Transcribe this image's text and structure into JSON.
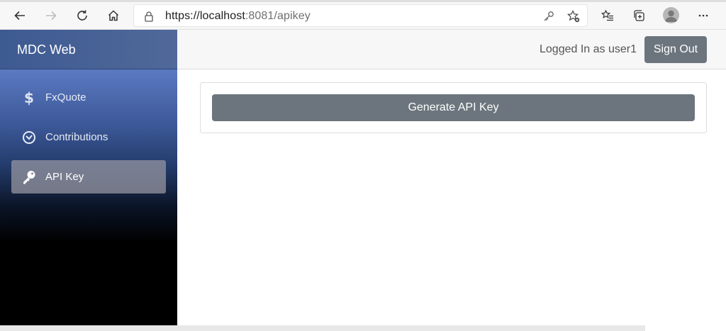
{
  "browser": {
    "url_host": "https://localhost",
    "url_rest": ":8081/apikey"
  },
  "app": {
    "brand": "MDC Web",
    "user_status": "Logged In as user1",
    "signout_label": "Sign Out"
  },
  "sidebar": {
    "items": [
      {
        "label": "FxQuote",
        "icon": "dollar-icon",
        "active": false
      },
      {
        "label": "Contributions",
        "icon": "gauge-icon",
        "active": false
      },
      {
        "label": "API Key",
        "icon": "key-icon",
        "active": true
      }
    ]
  },
  "main": {
    "generate_label": "Generate API Key"
  },
  "colors": {
    "button_gray": "#6c757d",
    "sidebar_top": "#6f8fd6",
    "sidebar_bottom": "#000000"
  }
}
